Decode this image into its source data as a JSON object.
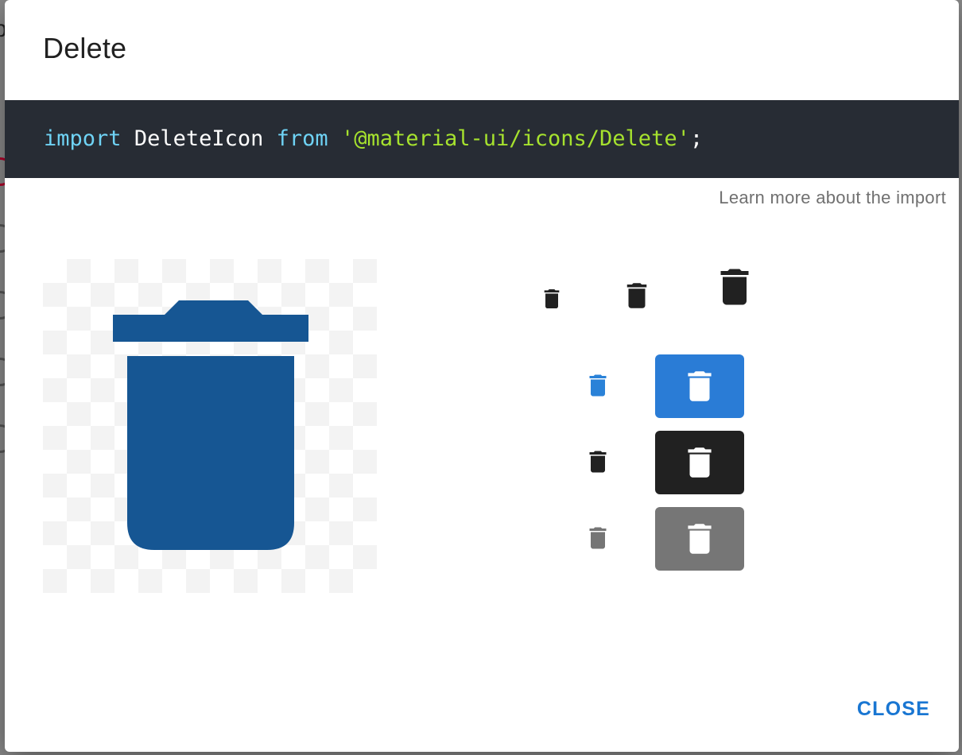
{
  "dialog": {
    "title": "Delete",
    "import_code": {
      "keyword_import": "import",
      "identifier": "DeleteIcon",
      "keyword_from": "from",
      "module": "'@material-ui/icons/Delete'",
      "terminator": ";"
    },
    "learn_more_label": "Learn more about the import",
    "close_label": "CLOSE"
  },
  "icon": {
    "name": "delete-icon",
    "preview_color": "#165693"
  },
  "colors": {
    "primary": "#1976d2",
    "icon_primary": "#2a82d8",
    "default": "#212121",
    "disabled": "#757575",
    "white": "#ffffff",
    "code_bg": "#272c34",
    "code_keyword": "#6fd3f5",
    "code_string": "#a6e22e"
  }
}
